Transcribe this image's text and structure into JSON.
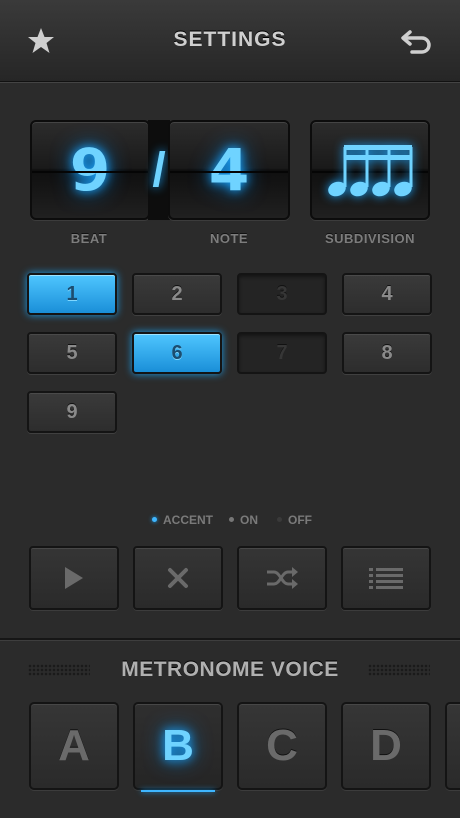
{
  "header": {
    "title": "SETTINGS",
    "left_icon": "star-icon",
    "right_icon": "back-arrow-icon"
  },
  "display": {
    "beat": "9",
    "separator": "/",
    "note": "4",
    "subdivision_icon": "sixteenth-notes-icon",
    "labels": {
      "beat": "BEAT",
      "note": "NOTE",
      "subdivision": "SUBDIVISION"
    }
  },
  "beats": [
    {
      "label": "1",
      "state": "accent"
    },
    {
      "label": "2",
      "state": "on"
    },
    {
      "label": "3",
      "state": "off"
    },
    {
      "label": "4",
      "state": "on"
    },
    {
      "label": "5",
      "state": "on"
    },
    {
      "label": "6",
      "state": "accent"
    },
    {
      "label": "7",
      "state": "off"
    },
    {
      "label": "8",
      "state": "on"
    },
    {
      "label": "9",
      "state": "on"
    }
  ],
  "legend": {
    "accent": "ACCENT",
    "on": "ON",
    "off": "OFF"
  },
  "actions": [
    {
      "name": "play-icon"
    },
    {
      "name": "clear-icon"
    },
    {
      "name": "shuffle-icon"
    },
    {
      "name": "list-icon"
    }
  ],
  "voice": {
    "title": "METRONOME VOICE",
    "options": [
      "A",
      "B",
      "C",
      "D"
    ],
    "selected": "B"
  },
  "colors": {
    "accent": "#3fb6ff",
    "background": "#2b2b2b"
  }
}
